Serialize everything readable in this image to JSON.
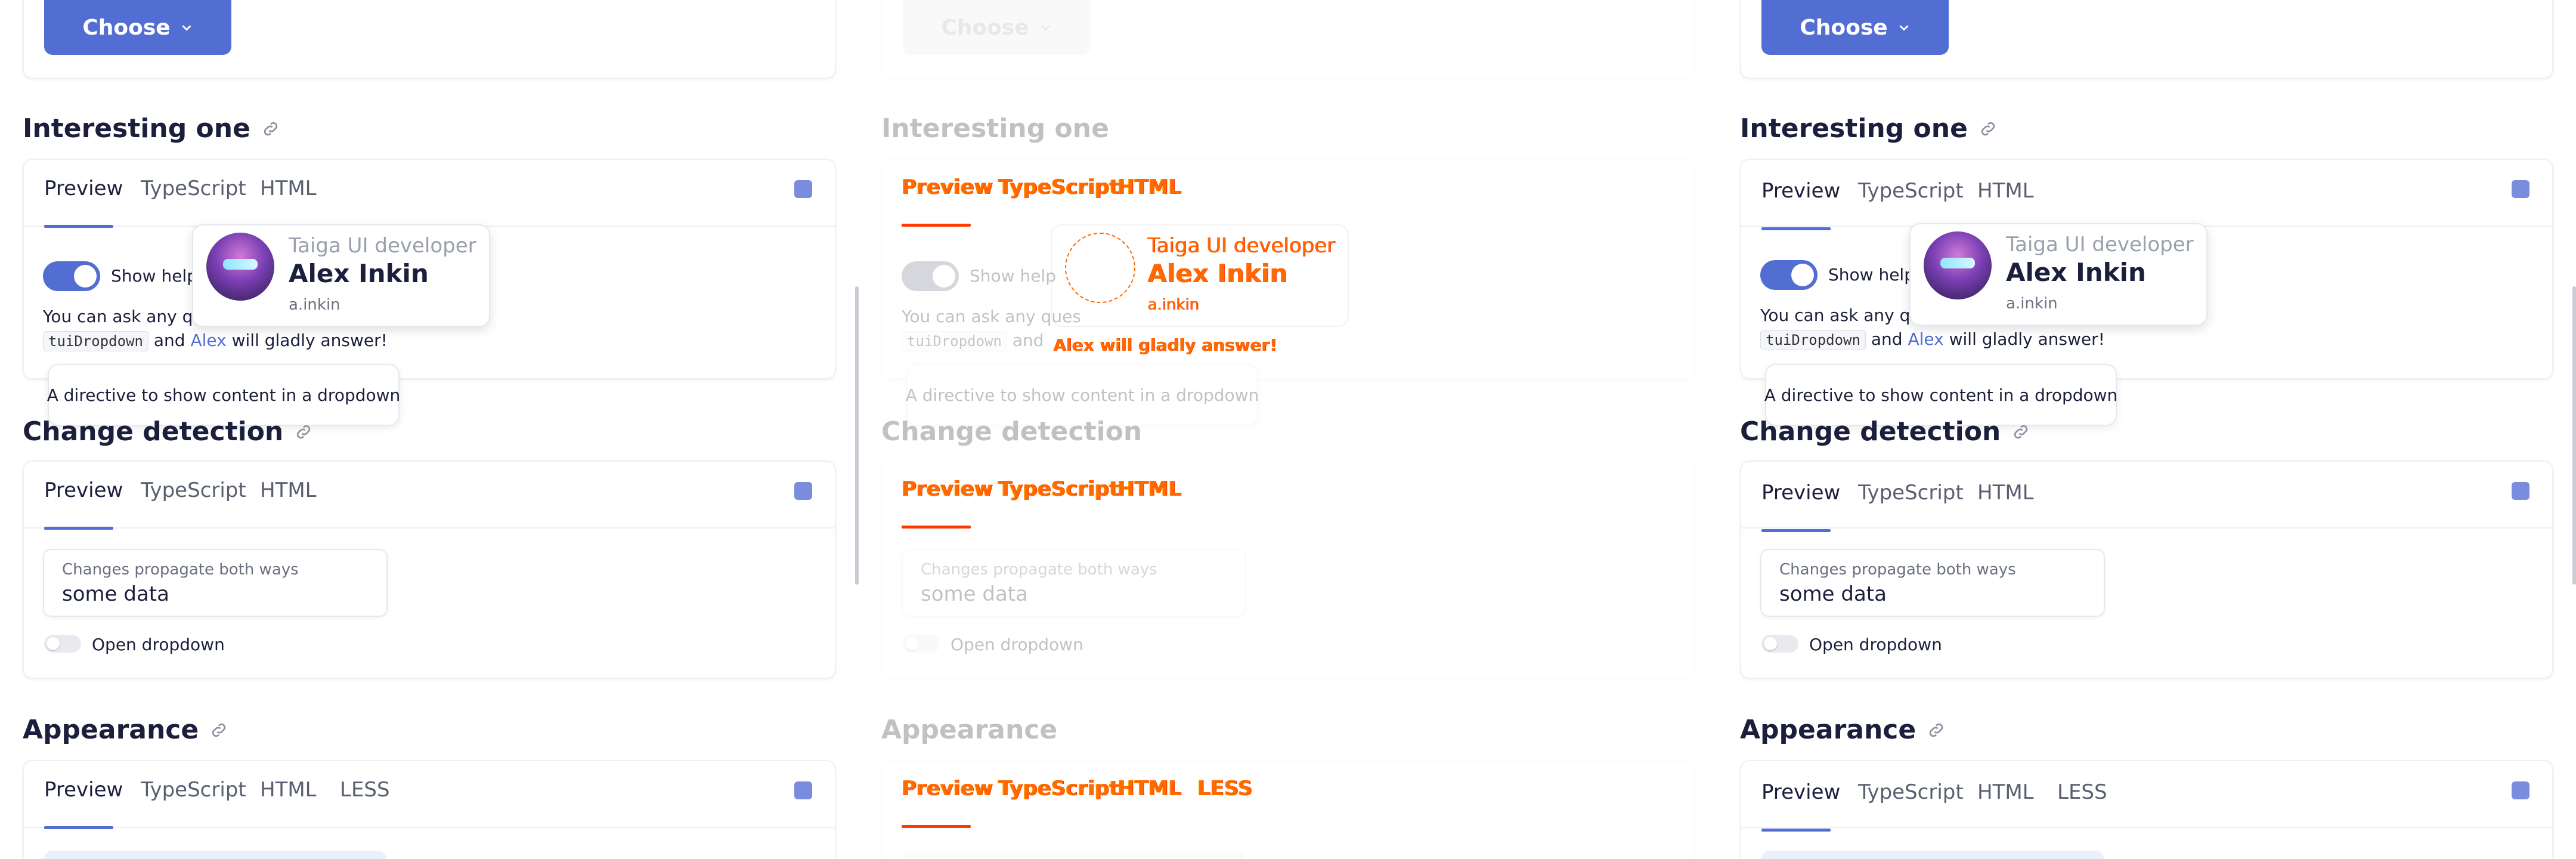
{
  "choose": {
    "label": "Choose"
  },
  "sections": {
    "interesting": {
      "title": "Interesting one"
    },
    "change": {
      "title": "Change detection"
    },
    "appearance": {
      "title": "Appearance"
    }
  },
  "tabs": {
    "preview": "Preview",
    "typescript": "TypeScript",
    "html": "HTML",
    "less": "LESS"
  },
  "interesting": {
    "show_help": "Show help",
    "ask_line_prefix": "You can ask any ques",
    "chip": "tuiDropdown",
    "and": "and",
    "alex": "Alex",
    "answer": "will gladly answer!"
  },
  "popover": {
    "role": "Taiga UI developer",
    "name": "Alex Inkin",
    "handle": "a.inkin"
  },
  "tooltip": {
    "text": "A directive to show content in a dropdown"
  },
  "change": {
    "input_label": "Changes propagate both ways",
    "input_value": "some data",
    "open_dropdown": "Open dropdown"
  },
  "colors": {
    "accent": "#526ed3",
    "diff": "#ff6a00"
  },
  "icons": {
    "chevron": "chevron-down-icon",
    "link": "link-icon",
    "fullscreen": "fullscreen-icon",
    "avatar": "avatar"
  }
}
